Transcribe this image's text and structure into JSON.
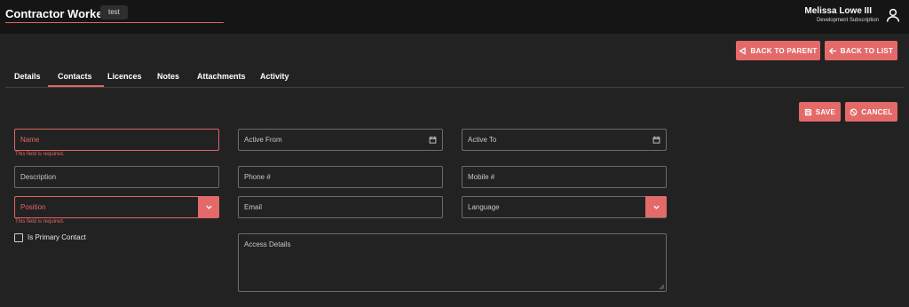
{
  "header": {
    "title": "Contractor Worker",
    "badge": "test",
    "user_name": "Melissa Lowe III",
    "subscription": "Development Subscription"
  },
  "nav_buttons": {
    "back_to_parent": "BACK TO PARENT",
    "back_to_list": "BACK TO LIST"
  },
  "tabs": [
    {
      "label": "Details"
    },
    {
      "label": "Contacts",
      "active": true
    },
    {
      "label": "Licences"
    },
    {
      "label": "Notes"
    },
    {
      "label": "Attachments"
    },
    {
      "label": "Activity"
    }
  ],
  "form_buttons": {
    "save": "SAVE",
    "cancel": "CANCEL"
  },
  "form": {
    "name": {
      "placeholder": "Name",
      "error": "This field is required."
    },
    "description": {
      "placeholder": "Description"
    },
    "position": {
      "placeholder": "Position",
      "error": "This field is required."
    },
    "is_primary_contact": {
      "label": "Is Primary Contact",
      "checked": false
    },
    "active_from": {
      "placeholder": "Active From"
    },
    "active_to": {
      "placeholder": "Active To"
    },
    "phone": {
      "placeholder": "Phone #"
    },
    "mobile": {
      "placeholder": "Mobile #"
    },
    "email": {
      "placeholder": "Email"
    },
    "language": {
      "placeholder": "Language"
    },
    "access_details": {
      "placeholder": "Access Details"
    }
  },
  "colors": {
    "accent": "#e46a6a",
    "error": "#e06666",
    "background": "#222222",
    "topbar": "#151515"
  }
}
